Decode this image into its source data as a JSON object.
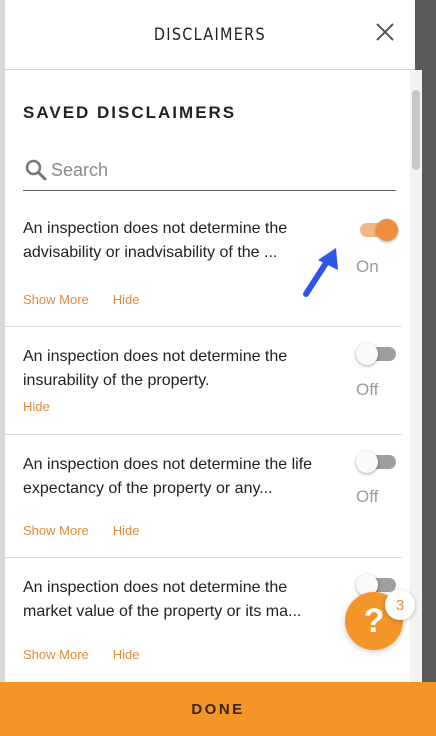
{
  "header": {
    "title": "DISCLAIMERS",
    "close_icon": "close-icon"
  },
  "section": {
    "title": "SAVED DISCLAIMERS"
  },
  "search": {
    "placeholder": "Search",
    "value": ""
  },
  "disclaimers": [
    {
      "text": "An inspection does not determine the advisability or inadvisability of the ...",
      "show_more": "Show More",
      "hide": "Hide",
      "enabled": true,
      "state_label": "On"
    },
    {
      "text": "An inspection does not determine the insurability of the property.",
      "show_more": "",
      "hide": "Hide",
      "enabled": false,
      "state_label": "Off"
    },
    {
      "text": "An inspection does not determine the life expectancy of the property or any...",
      "show_more": "Show More",
      "hide": "Hide",
      "enabled": false,
      "state_label": "Off"
    },
    {
      "text": "An inspection does not determine the market value of the property or its ma...",
      "show_more": "Show More",
      "hide": "Hide",
      "enabled": false,
      "state_label": ""
    }
  ],
  "footer": {
    "done_label": "DONE"
  },
  "help": {
    "label": "?",
    "badge_count": "3"
  },
  "colors": {
    "accent": "#f39528",
    "link": "#e8893a",
    "arrow": "#2f55e6"
  }
}
